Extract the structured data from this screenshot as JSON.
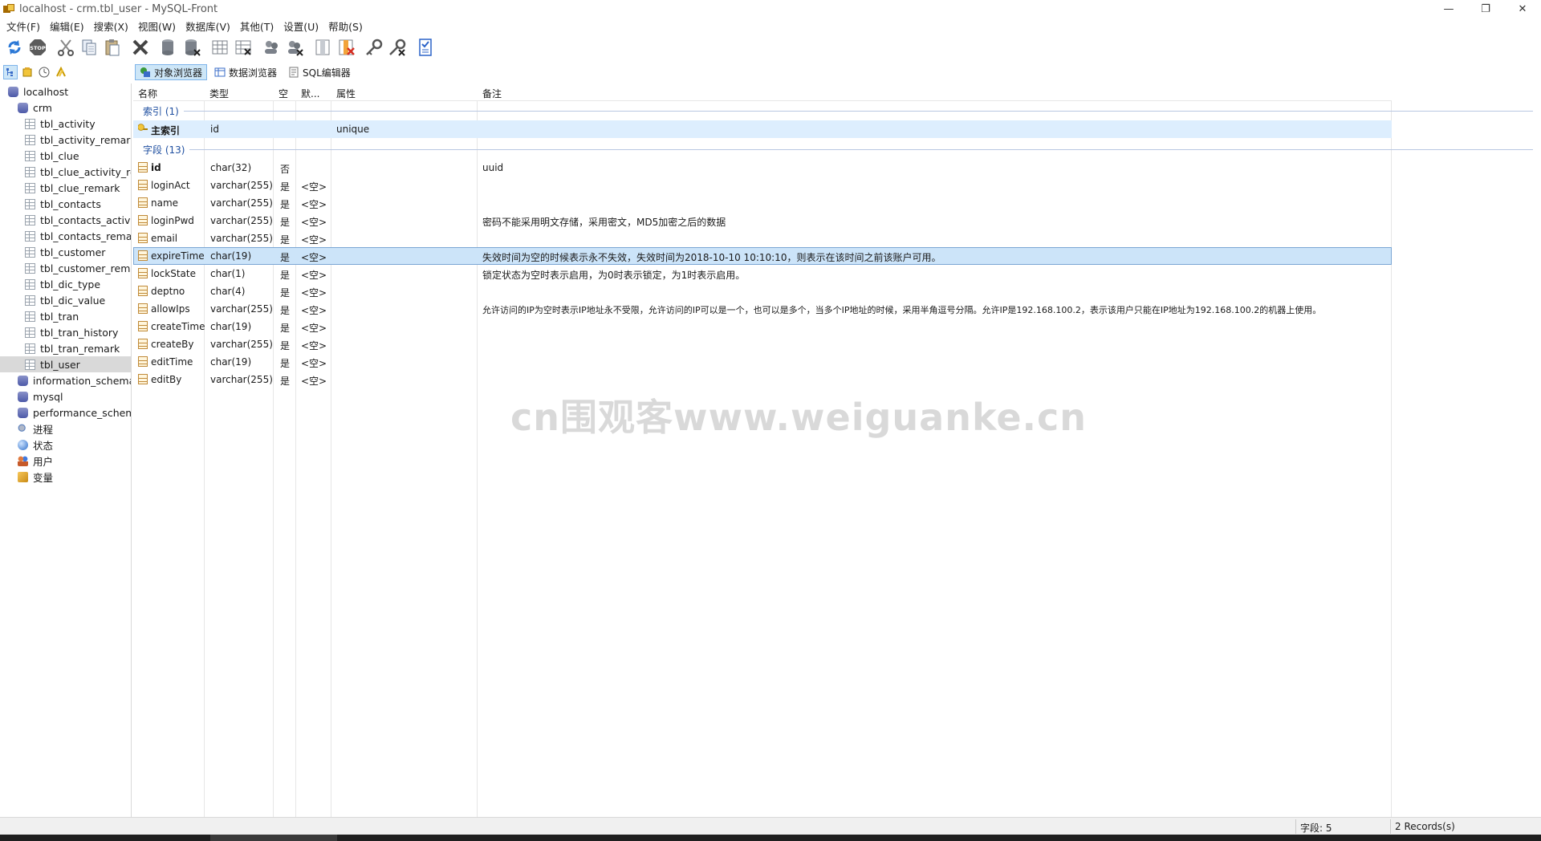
{
  "window": {
    "title": "localhost - crm.tbl_user - MySQL-Front",
    "controls": [
      "—",
      "❐",
      "✕"
    ]
  },
  "menu": [
    "文件(F)",
    "编辑(E)",
    "搜索(X)",
    "视图(W)",
    "数据库(V)",
    "其他(T)",
    "设置(U)",
    "帮助(S)"
  ],
  "toolbar": {
    "icons": [
      "refresh-icon",
      "stop-icon",
      "cut-icon",
      "copy-icon",
      "paste-icon",
      "delete-icon",
      "db-create-icon",
      "db-delete-icon",
      "table-create-icon",
      "table-delete-icon",
      "user-create-icon",
      "user-delete-icon",
      "column-create-icon",
      "column-delete-icon",
      "key-create-icon",
      "key-delete-icon",
      "checklist-icon"
    ],
    "stop_label": "STOP"
  },
  "side_tools": [
    "tree-icon",
    "bookmark-icon",
    "history-icon",
    "sql-files-icon"
  ],
  "view_tabs": [
    {
      "label": "对象浏览器",
      "icon": "object-browser-icon",
      "active": true
    },
    {
      "label": "数据浏览器",
      "icon": "data-browser-icon",
      "active": false
    },
    {
      "label": "SQL编辑器",
      "icon": "sql-editor-icon",
      "active": false
    }
  ],
  "tree": {
    "root": "localhost",
    "db": "crm",
    "tables": [
      "tbl_activity",
      "tbl_activity_remark",
      "tbl_clue",
      "tbl_clue_activity_rela",
      "tbl_clue_remark",
      "tbl_contacts",
      "tbl_contacts_activity",
      "tbl_contacts_remark",
      "tbl_customer",
      "tbl_customer_remar",
      "tbl_dic_type",
      "tbl_dic_value",
      "tbl_tran",
      "tbl_tran_history",
      "tbl_tran_remark",
      "tbl_user"
    ],
    "selected_table": "tbl_user",
    "other_dbs": [
      "information_schema",
      "mysql",
      "performance_schema"
    ],
    "extras": [
      {
        "label": "进程",
        "icon": "process-icon"
      },
      {
        "label": "状态",
        "icon": "status-icon"
      },
      {
        "label": "用户",
        "icon": "users-icon"
      },
      {
        "label": "变量",
        "icon": "variables-icon"
      }
    ]
  },
  "grid": {
    "headers": [
      "名称",
      "类型",
      "空",
      "默...",
      "属性",
      "备注"
    ],
    "index_group": "索引 (1)",
    "index_rows": [
      {
        "name": "主索引",
        "type": "id",
        "null": "",
        "default": "",
        "attr": "unique",
        "comment": ""
      }
    ],
    "field_group": "字段 (13)",
    "field_rows": [
      {
        "name": "id",
        "type": "char(32)",
        "null": "否",
        "default": "",
        "comment": "uuid",
        "bold": true
      },
      {
        "name": "loginAct",
        "type": "varchar(255)",
        "null": "是",
        "default": "<空>",
        "comment": ""
      },
      {
        "name": "name",
        "type": "varchar(255)",
        "null": "是",
        "default": "<空>",
        "comment": ""
      },
      {
        "name": "loginPwd",
        "type": "varchar(255)",
        "null": "是",
        "default": "<空>",
        "comment": "密码不能采用明文存储，采用密文，MD5加密之后的数据"
      },
      {
        "name": "email",
        "type": "varchar(255)",
        "null": "是",
        "default": "<空>",
        "comment": ""
      },
      {
        "name": "expireTime",
        "type": "char(19)",
        "null": "是",
        "default": "<空>",
        "comment": "失效时间为空的时候表示永不失效，失效时间为2018-10-10 10:10:10，则表示在该时间之前该账户可用。",
        "selected": true
      },
      {
        "name": "lockState",
        "type": "char(1)",
        "null": "是",
        "default": "<空>",
        "comment": "锁定状态为空时表示启用，为0时表示锁定，为1时表示启用。"
      },
      {
        "name": "deptno",
        "type": "char(4)",
        "null": "是",
        "default": "<空>",
        "comment": ""
      },
      {
        "name": "allowIps",
        "type": "varchar(255)",
        "null": "是",
        "default": "<空>",
        "comment": "允许访问的IP为空时表示IP地址永不受限，允许访问的IP可以是一个，也可以是多个，当多个IP地址的时候，采用半角逗号分隔。允许IP是192.168.100.2，表示该用户只能在IP地址为192.168.100.2的机器上使用。"
      },
      {
        "name": "createTime",
        "type": "char(19)",
        "null": "是",
        "default": "<空>",
        "comment": ""
      },
      {
        "name": "createBy",
        "type": "varchar(255)",
        "null": "是",
        "default": "<空>",
        "comment": ""
      },
      {
        "name": "editTime",
        "type": "char(19)",
        "null": "是",
        "default": "<空>",
        "comment": ""
      },
      {
        "name": "editBy",
        "type": "varchar(255)",
        "null": "是",
        "default": "<空>",
        "comment": ""
      }
    ]
  },
  "watermark": "cn围观客www.weiguanke.cn",
  "status": {
    "fields": "字段: 5",
    "records": "2 Records(s)"
  }
}
